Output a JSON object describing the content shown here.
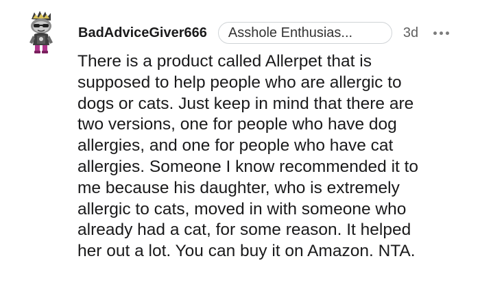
{
  "comment": {
    "username": "BadAdviceGiver666",
    "flair": "Asshole Enthusias...",
    "age": "3d",
    "more_icon": "ellipsis-icon",
    "avatar_icon": "snoo-avatar-icon",
    "body_lines": [
      "There is a product called Allerpet that is",
      "supposed to help people who are allergic to",
      "dogs or cats. Just keep in mind that there are",
      "two versions, one for people who have dog",
      "allergies, and one for people who have cat",
      "allergies. Someone I know recommended it to",
      "me because his daughter, who is extremely",
      "allergic to cats, moved in with someone who",
      "already had a cat, for some reason. It helped",
      "her out a lot. You can buy it on Amazon. NTA."
    ]
  }
}
